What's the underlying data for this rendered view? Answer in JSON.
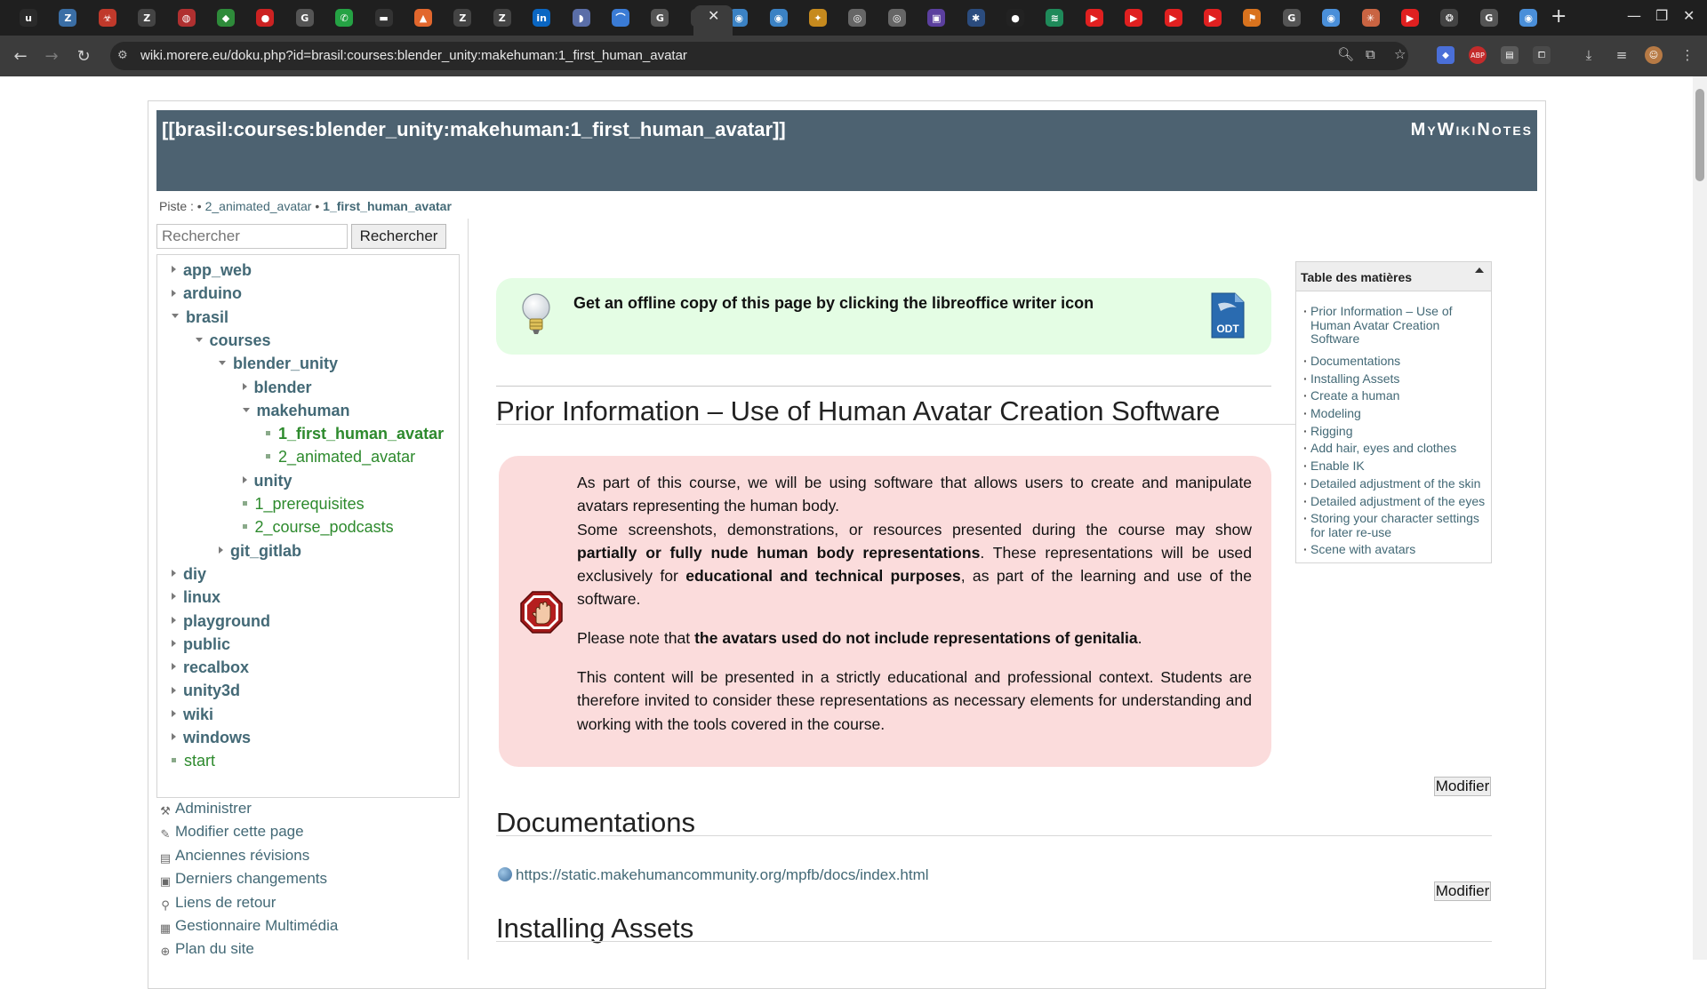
{
  "browser": {
    "url": "wiki.morere.eu/doku.php?id=brasil:courses:blender_unity:makehuman:1_first_human_avatar",
    "tabs": [
      {
        "icon": "u-icon",
        "glyph": "u",
        "color": "#2a2a2a"
      },
      {
        "icon": "z-icon",
        "glyph": "Z",
        "color": "#3a6ea5"
      },
      {
        "icon": "biohazard-icon",
        "glyph": "☣",
        "color": "#c0392b"
      },
      {
        "icon": "zotero-icon",
        "glyph": "Z",
        "color": "#444444"
      },
      {
        "icon": "swirl-icon",
        "glyph": "◍",
        "color": "#b03030"
      },
      {
        "icon": "brazil-flag-icon",
        "glyph": "◆",
        "color": "#2e8b3a"
      },
      {
        "icon": "red-circle-icon",
        "glyph": "●",
        "color": "#cc2222"
      },
      {
        "icon": "google-icon",
        "glyph": "G",
        "color": "#555555"
      },
      {
        "icon": "whatsapp-icon",
        "glyph": "✆",
        "color": "#25a244"
      },
      {
        "icon": "dash-icon",
        "glyph": "▬",
        "color": "#333333"
      },
      {
        "icon": "gitlab-icon",
        "glyph": "▲",
        "color": "#e2672d"
      },
      {
        "icon": "zotero-icon",
        "glyph": "Z",
        "color": "#444444"
      },
      {
        "icon": "zotero-alt-icon",
        "glyph": "Z",
        "color": "#444444"
      },
      {
        "icon": "linkedin-icon",
        "glyph": "in",
        "color": "#0a66c2"
      },
      {
        "icon": "bookmark-icon",
        "glyph": "◗",
        "color": "#5a6ea8"
      },
      {
        "icon": "signal-icon",
        "glyph": "⌒",
        "color": "#3a7bd5"
      },
      {
        "icon": "google-icon",
        "glyph": "G",
        "color": "#555555"
      },
      {
        "icon": "wiki-icon",
        "glyph": "✕",
        "color": "#3c3c3c"
      },
      {
        "icon": "blue-bird-icon",
        "glyph": "◉",
        "color": "#3b82c4"
      },
      {
        "icon": "blue-bird-icon",
        "glyph": "◉",
        "color": "#3b82c4"
      },
      {
        "icon": "pinwheel-icon",
        "glyph": "✦",
        "color": "#c68a1e"
      },
      {
        "icon": "globe-icon",
        "glyph": "◎",
        "color": "#666666"
      },
      {
        "icon": "globe-icon",
        "glyph": "◎",
        "color": "#666666"
      },
      {
        "icon": "purple-app-icon",
        "glyph": "▣",
        "color": "#5b3f9e"
      },
      {
        "icon": "star-app-icon",
        "glyph": "✱",
        "color": "#2b4c7e"
      },
      {
        "icon": "github-icon",
        "glyph": "●",
        "color": "#222222"
      },
      {
        "icon": "audio-wave-icon",
        "glyph": "≋",
        "color": "#1f8a5a"
      },
      {
        "icon": "youtube-icon",
        "glyph": "▶",
        "color": "#e02020"
      },
      {
        "icon": "youtube-icon",
        "glyph": "▶",
        "color": "#e02020"
      },
      {
        "icon": "youtube-icon",
        "glyph": "▶",
        "color": "#e02020"
      },
      {
        "icon": "youtube-icon",
        "glyph": "▶",
        "color": "#e02020"
      },
      {
        "icon": "runner-icon",
        "glyph": "⚑",
        "color": "#d9731e"
      },
      {
        "icon": "google-icon",
        "glyph": "G",
        "color": "#555555"
      },
      {
        "icon": "blue-app-icon",
        "glyph": "◉",
        "color": "#4a8fd9"
      },
      {
        "icon": "claude-icon",
        "glyph": "✳",
        "color": "#c96442"
      },
      {
        "icon": "youtube-icon",
        "glyph": "▶",
        "color": "#e02020"
      },
      {
        "icon": "chatgpt-icon",
        "glyph": "❂",
        "color": "#444444"
      },
      {
        "icon": "google-icon",
        "glyph": "G",
        "color": "#555555"
      },
      {
        "icon": "blue-app-icon",
        "glyph": "◉",
        "color": "#4a8fd9"
      }
    ],
    "new_tab_glyph": "+",
    "close_glyph": "✕"
  },
  "wiki": {
    "page_title": "[[brasil:courses:blender_unity:makehuman:1_first_human_avatar]]",
    "site_name": "MyWikiNotes",
    "trace": {
      "label": "Piste :",
      "bullet": "•",
      "items": [
        "2_animated_avatar",
        "1_first_human_avatar"
      ]
    },
    "search": {
      "placeholder": "Rechercher",
      "button": "Rechercher"
    },
    "tree": [
      {
        "label": "app_web",
        "kind": "ns-closed",
        "depth": 0
      },
      {
        "label": "arduino",
        "kind": "ns-closed",
        "depth": 0
      },
      {
        "label": "brasil",
        "kind": "ns-open",
        "depth": 0
      },
      {
        "label": "courses",
        "kind": "ns-open",
        "depth": 1
      },
      {
        "label": "blender_unity",
        "kind": "ns-open",
        "depth": 2
      },
      {
        "label": "blender",
        "kind": "ns-closed",
        "depth": 3
      },
      {
        "label": "makehuman",
        "kind": "ns-open",
        "depth": 3
      },
      {
        "label": "1_first_human_avatar",
        "kind": "page-current",
        "depth": 4
      },
      {
        "label": "2_animated_avatar",
        "kind": "page",
        "depth": 4
      },
      {
        "label": "unity",
        "kind": "ns-closed",
        "depth": 3
      },
      {
        "label": "1_prerequisites",
        "kind": "page",
        "depth": 3
      },
      {
        "label": "2_course_podcasts",
        "kind": "page",
        "depth": 3
      },
      {
        "label": "git_gitlab",
        "kind": "ns-closed",
        "depth": 2
      },
      {
        "label": "diy",
        "kind": "ns-closed",
        "depth": 0
      },
      {
        "label": "linux",
        "kind": "ns-closed",
        "depth": 0
      },
      {
        "label": "playground",
        "kind": "ns-closed",
        "depth": 0
      },
      {
        "label": "public",
        "kind": "ns-closed",
        "depth": 0
      },
      {
        "label": "recalbox",
        "kind": "ns-closed",
        "depth": 0
      },
      {
        "label": "unity3d",
        "kind": "ns-closed",
        "depth": 0
      },
      {
        "label": "wiki",
        "kind": "ns-closed",
        "depth": 0
      },
      {
        "label": "windows",
        "kind": "ns-closed",
        "depth": 0
      },
      {
        "label": "start",
        "kind": "page",
        "depth": 0
      }
    ],
    "tools": [
      {
        "label": "Administrer",
        "icon": "admin-tools-icon",
        "glyph": "⚒"
      },
      {
        "label": "Modifier cette page",
        "icon": "edit-page-icon",
        "glyph": "✎"
      },
      {
        "label": "Anciennes révisions",
        "icon": "old-revisions-icon",
        "glyph": "▤"
      },
      {
        "label": "Derniers changements",
        "icon": "recent-changes-icon",
        "glyph": "▣"
      },
      {
        "label": "Liens de retour",
        "icon": "backlinks-icon",
        "glyph": "⚲"
      },
      {
        "label": "Gestionnaire Multimédia",
        "icon": "media-manager-icon",
        "glyph": "▦"
      },
      {
        "label": "Plan du site",
        "icon": "sitemap-icon",
        "glyph": "⊕"
      }
    ],
    "notice": "Get an offline copy of this page by clicking the libreoffice writer icon",
    "odt_label": "ODT",
    "section1": {
      "title": "Prior Information – Use of Human Avatar Creation Software",
      "p1a": "As part of this course, we will be using software that allows users to create and manipulate avatars representing the human body.",
      "p1b_pre": "Some screenshots, demonstrations, or resources presented during the course may show ",
      "p1b_bold1": "partially or fully nude human body representations",
      "p1b_mid": ". These representations will be used exclusively for ",
      "p1b_bold2": "educational and technical purposes",
      "p1b_post": ", as part of the learning and use of the software.",
      "p2_pre": "Please note that ",
      "p2_bold": "the avatars used do not include representations of genitalia",
      "p2_post": ".",
      "p3": "This content will be presented in a strictly educational and professional context. Students are therefore invited to consider these representations as necessary elements for understanding and working with the tools covered in the course."
    },
    "edit_button": "Modifier",
    "section2": {
      "title": "Documentations",
      "link": "https://static.makehumancommunity.org/mpfb/docs/index.html"
    },
    "section3": {
      "title": "Installing Assets"
    },
    "toc": {
      "title": "Table des matières",
      "items": [
        "Prior Information – Use of Human Avatar Creation Software",
        "Documentations",
        "Installing Assets",
        "Create a human",
        "Modeling",
        "Rigging",
        "Add hair, eyes and clothes",
        "Enable IK",
        "Detailed adjustment of the skin",
        "Detailed adjustment of the eyes",
        "Storing your character settings for later re-use",
        "Scene with avatars"
      ]
    },
    "colors": {
      "header": "#4d6271",
      "link": "#436976",
      "page_link": "#2d8a2d",
      "notice_bg": "#e4fde4",
      "warning_bg": "#fbdcdc"
    }
  }
}
